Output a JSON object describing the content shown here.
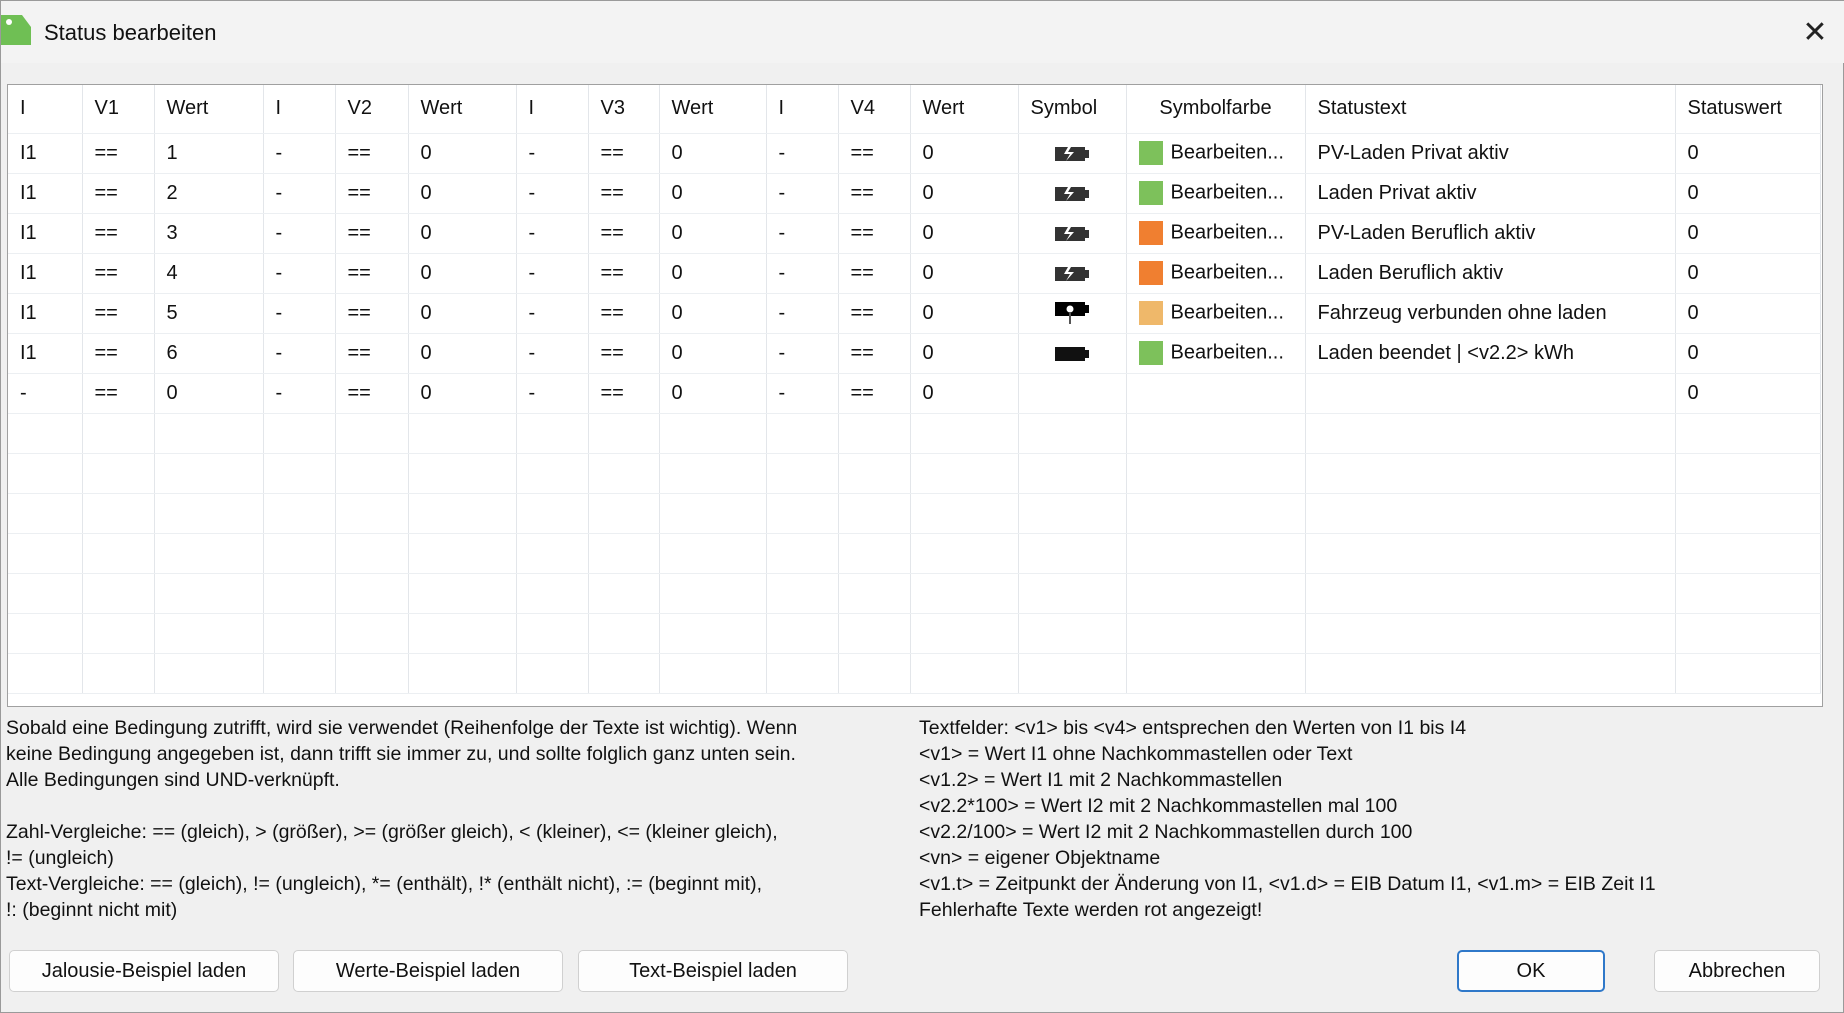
{
  "window": {
    "title": "Status bearbeiten",
    "icon": "config-app-icon",
    "close": "✕"
  },
  "table": {
    "headers": [
      "I",
      "V1",
      "Wert",
      "I",
      "V2",
      "Wert",
      "I",
      "V3",
      "Wert",
      "I",
      "V4",
      "Wert",
      "Symbol",
      "Symbolfarbe",
      "Statustext",
      "Statuswert"
    ],
    "rows": [
      {
        "cells": [
          "I1",
          "==",
          "1",
          "-",
          "==",
          "0",
          "-",
          "==",
          "0",
          "-",
          "==",
          "0"
        ],
        "symbol": "battery-charging-icon",
        "color": "#7dc15b",
        "color_label": "Bearbeiten...",
        "text": "PV-Laden Privat aktiv",
        "value": "0"
      },
      {
        "cells": [
          "I1",
          "==",
          "2",
          "-",
          "==",
          "0",
          "-",
          "==",
          "0",
          "-",
          "==",
          "0"
        ],
        "symbol": "battery-charging-icon",
        "color": "#7dc15b",
        "color_label": "Bearbeiten...",
        "text": "Laden Privat aktiv",
        "value": "0"
      },
      {
        "cells": [
          "I1",
          "==",
          "3",
          "-",
          "==",
          "0",
          "-",
          "==",
          "0",
          "-",
          "==",
          "0"
        ],
        "symbol": "battery-charging-icon",
        "color": "#f07f30",
        "color_label": "Bearbeiten...",
        "text": "PV-Laden Beruflich aktiv",
        "value": "0"
      },
      {
        "cells": [
          "I1",
          "==",
          "4",
          "-",
          "==",
          "0",
          "-",
          "==",
          "0",
          "-",
          "==",
          "0"
        ],
        "symbol": "battery-charging-icon",
        "color": "#f07f30",
        "color_label": "Bearbeiten...",
        "text": "Laden Beruflich aktiv",
        "value": "0"
      },
      {
        "cells": [
          "I1",
          "==",
          "5",
          "-",
          "==",
          "0",
          "-",
          "==",
          "0",
          "-",
          "==",
          "0"
        ],
        "symbol": "battery-plug-icon",
        "color": "#efb86a",
        "color_label": "Bearbeiten...",
        "text": "Fahrzeug verbunden ohne laden",
        "value": "0"
      },
      {
        "cells": [
          "I1",
          "==",
          "6",
          "-",
          "==",
          "0",
          "-",
          "==",
          "0",
          "-",
          "==",
          "0"
        ],
        "symbol": "battery-full-icon",
        "color": "#7dc15b",
        "color_label": "Bearbeiten...",
        "text": "Laden beendet | <v2.2> kWh",
        "value": "0"
      },
      {
        "cells": [
          "-",
          "==",
          "0",
          "-",
          "==",
          "0",
          "-",
          "==",
          "0",
          "-",
          "==",
          "0"
        ],
        "symbol": "",
        "color": "",
        "color_label": "",
        "text": "",
        "value": "0"
      }
    ]
  },
  "help_left": "Sobald eine Bedingung zutrifft, wird sie verwendet (Reihenfolge der Texte ist wichtig). Wenn\nkeine Bedingung angegeben ist, dann trifft sie immer zu, und sollte folglich ganz unten sein.\nAlle Bedingungen sind UND-verknüpft.\n\nZahl-Vergleiche: == (gleich), > (größer), >= (größer gleich), < (kleiner), <= (kleiner gleich),\n!= (ungleich)\nText-Vergleiche: == (gleich), != (ungleich), *= (enthält), !* (enthält nicht), := (beginnt mit),\n!: (beginnt nicht mit)",
  "help_right": "Textfelder: <v1> bis <v4> entsprechen den Werten von I1 bis I4\n<v1> = Wert I1 ohne Nachkommastellen oder Text\n<v1.2> = Wert I1 mit 2 Nachkommastellen\n<v2.2*100> = Wert I2 mit 2 Nachkommastellen mal 100\n<v2.2/100> = Wert I2 mit 2 Nachkommastellen durch 100\n<vn> = eigener Objektname\n<v1.t> = Zeitpunkt der Änderung von I1, <v1.d> = EIB Datum I1, <v1.m> = EIB Zeit I1\nFehlerhafte Texte werden rot angezeigt!",
  "buttons": {
    "jalousie": "Jalousie-Beispiel laden",
    "werte": "Werte-Beispiel laden",
    "text": "Text-Beispiel laden",
    "ok": "OK",
    "cancel": "Abbrechen"
  }
}
